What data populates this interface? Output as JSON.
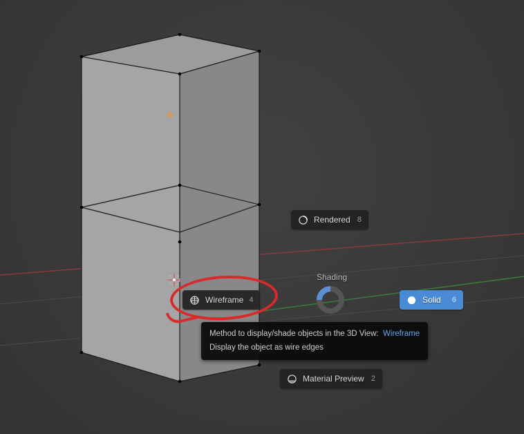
{
  "center_label": "Shading",
  "pie": {
    "rendered": {
      "label": "Rendered",
      "shortcut": "8"
    },
    "wireframe": {
      "label": "Wireframe",
      "shortcut": "4"
    },
    "solid": {
      "label": "Solid",
      "shortcut": "6"
    },
    "material": {
      "label": "Material Preview",
      "shortcut": "2"
    }
  },
  "tooltip": {
    "line1_prefix": "Method to display/shade objects in the 3D View:",
    "line1_value": "Wireframe",
    "line2": "Display the object as wire edges"
  }
}
